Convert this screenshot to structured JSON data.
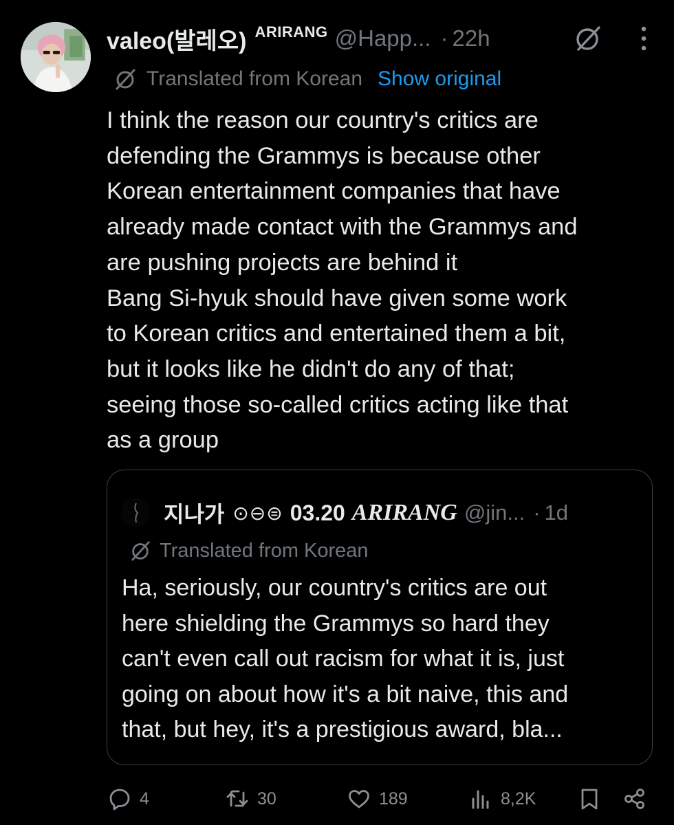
{
  "author": {
    "display_name": "valeo(발레오)",
    "badge": "ARIRANG",
    "handle": "@Happ...",
    "time": "22h"
  },
  "translation": {
    "label": "Translated from Korean",
    "show_original": "Show original"
  },
  "tweet_lines": [
    "I think the reason our country's critics are",
    "defending the Grammys is because other",
    "Korean entertainment companies that have",
    "already made contact with the Grammys and",
    "are pushing projects are behind it",
    "Bang Si-hyuk should have given some work",
    "to Korean critics and entertained them a bit,",
    "but it looks like he didn't do any of that;",
    "seeing those so-called critics acting like that",
    "as a group"
  ],
  "quote": {
    "display_name": "지나가",
    "symbols": "⊙⊖⊜",
    "date": "03.20",
    "badge": "ARIRANG",
    "handle": "@jin...",
    "time": "1d",
    "translated_label": "Translated from Korean",
    "lines": [
      "Ha, seriously, our country's critics are out",
      "here shielding the Grammys so hard they",
      "can't even call out racism for what it is, just",
      "going on about how it's a bit naive, this and",
      "that, but hey, it's a prestigious award, bla..."
    ]
  },
  "actions": {
    "replies": "4",
    "reposts": "30",
    "likes": "189",
    "views": "8,2K"
  },
  "icons": {
    "reply": "reply-icon",
    "repost": "repost-icon",
    "like": "heart-icon",
    "views": "views-icon",
    "bookmark": "bookmark-icon",
    "share": "share-icon",
    "grok": "grok-icon",
    "more": "more-icon",
    "translate": "translate-icon"
  },
  "colors": {
    "background": "#000000",
    "text": "#e7e9ea",
    "muted": "#71767b",
    "link": "#1d9bf0",
    "border": "#3a3f44"
  }
}
